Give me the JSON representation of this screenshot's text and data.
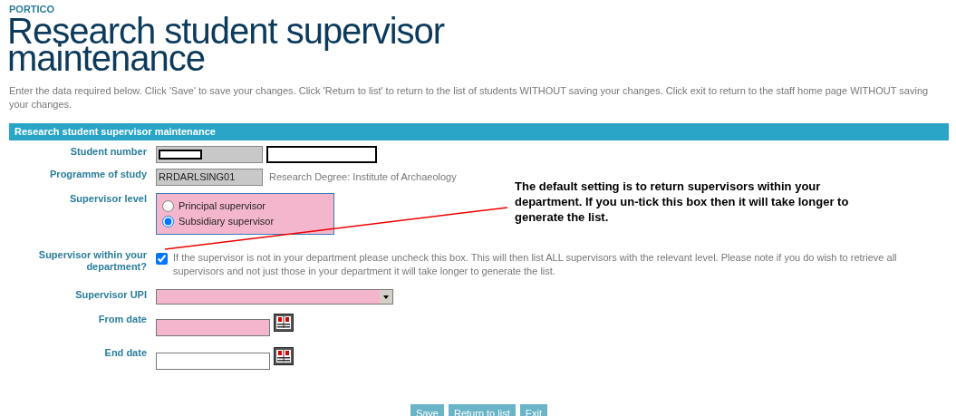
{
  "brand": "PORTICO",
  "title": "Research student supervisor maintenance",
  "intro": "Enter the data required below. Click 'Save' to save your changes. Click 'Return to list' to return to the list of students WITHOUT saving your changes. Click exit to return to the staff home page WITHOUT saving your changes.",
  "section_title": "Research student supervisor maintenance",
  "fields": [
    {
      "kind": "pair",
      "label": "Student number"
    },
    {
      "kind": "code",
      "label": "Programme of study",
      "value": "RRDARLSING01",
      "note": "Research Degree: Institute of Archaeology"
    },
    {
      "kind": "radios",
      "label": "Supervisor level",
      "options": [
        {
          "label": "Principal supervisor",
          "selected": false
        },
        {
          "label": "Subsidiary supervisor",
          "selected": true
        }
      ]
    },
    {
      "kind": "check",
      "label": "Supervisor within your department?",
      "checked": true,
      "note": "If the supervisor is not in your department please uncheck this box. This will then list ALL supervisors with the relevant level. Please note if you do wish to retrieve all supervisors and not just those in your department it will take longer to generate the list."
    },
    {
      "kind": "select",
      "label": "Supervisor UPI",
      "required": true
    },
    {
      "kind": "date",
      "label": "From date",
      "required": true
    },
    {
      "kind": "date",
      "label": "End date",
      "required": false
    }
  ],
  "buttons": [
    "Save",
    "Return to list",
    "Exit"
  ],
  "callout": "The default setting is to return supervisors within your department. If you un-tick this box then it will take longer to generate the list."
}
